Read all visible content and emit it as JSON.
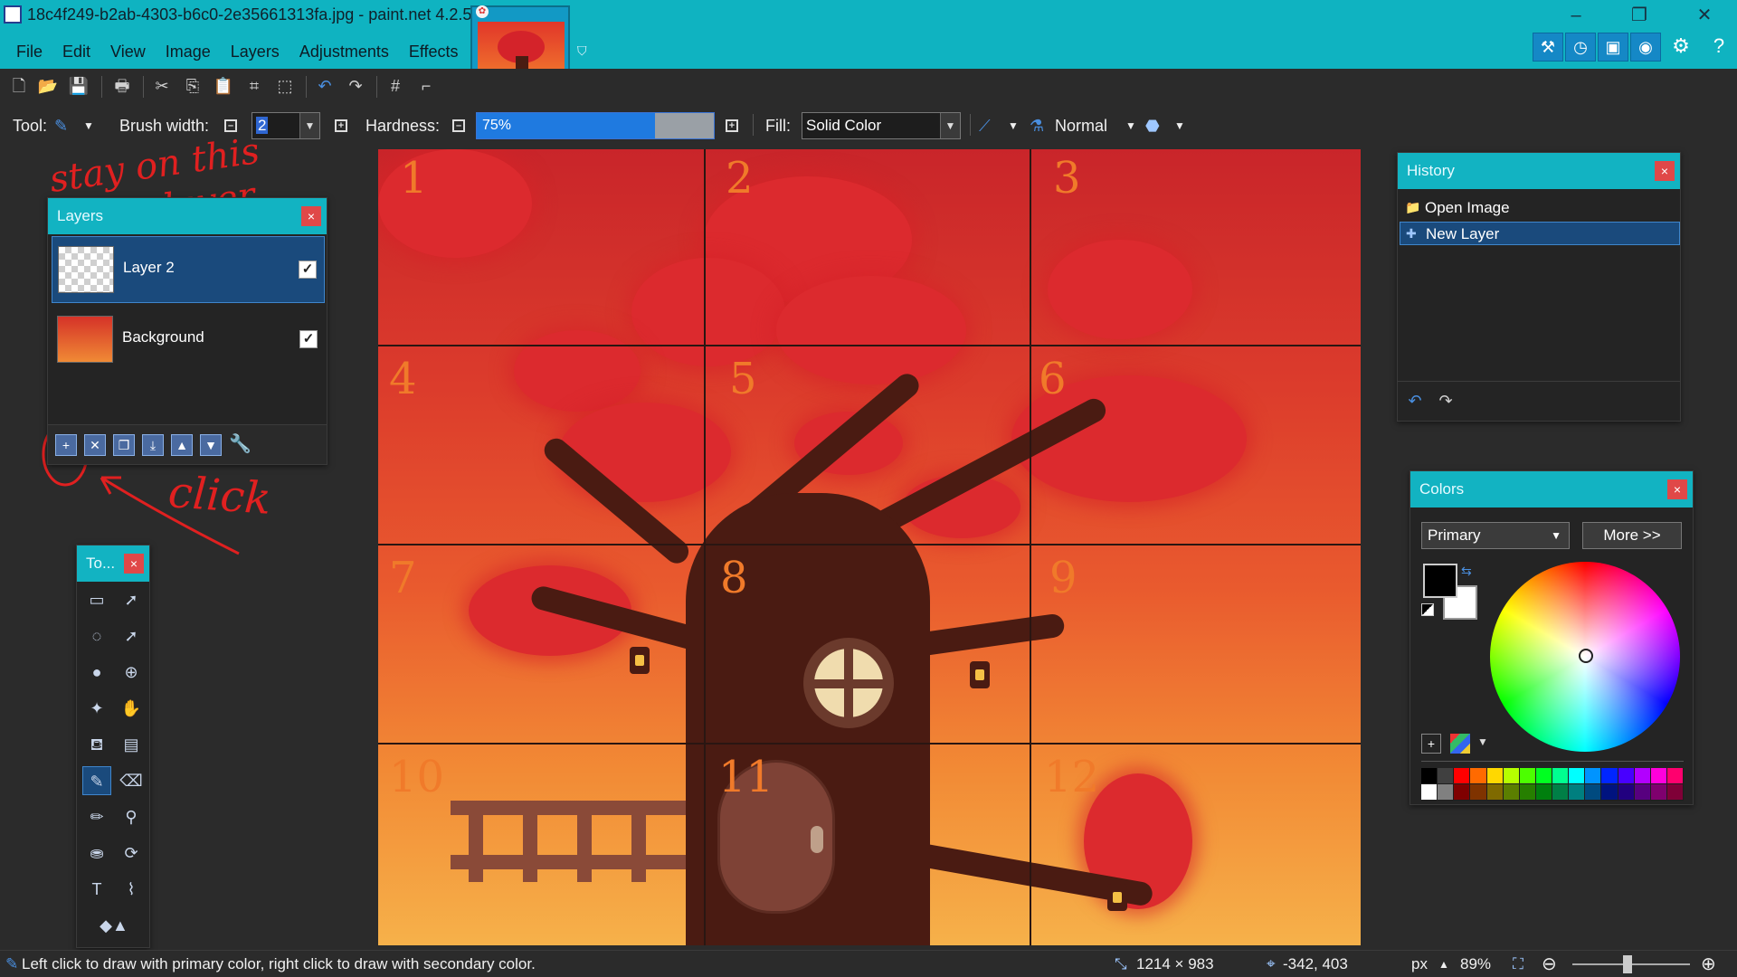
{
  "window": {
    "title": "18c4f249-b2ab-4303-b6c0-2e35661313fa.jpg - paint.net 4.2.5"
  },
  "menu": [
    "File",
    "Edit",
    "View",
    "Image",
    "Layers",
    "Adjustments",
    "Effects"
  ],
  "toolbar": {
    "tool_label": "Tool:",
    "brush_width_label": "Brush width:",
    "brush_width_value": "2",
    "hardness_label": "Hardness:",
    "hardness_value": "75%",
    "hardness_fraction": 0.75,
    "fill_label": "Fill:",
    "fill_value": "Solid Color",
    "blend_mode": "Normal"
  },
  "layers_panel": {
    "title": "Layers",
    "layers": [
      {
        "name": "Layer 2",
        "visible": true,
        "selected": true
      },
      {
        "name": "Background",
        "visible": true,
        "selected": false
      }
    ]
  },
  "tools_panel": {
    "title": "To..."
  },
  "history_panel": {
    "title": "History",
    "items": [
      {
        "label": "Open Image",
        "selected": false
      },
      {
        "label": "New Layer",
        "selected": true
      }
    ]
  },
  "colors_panel": {
    "title": "Colors",
    "mode": "Primary",
    "more_label": "More >>",
    "primary_color": "#000000",
    "secondary_color": "#ffffff",
    "palette": [
      "#000000",
      "#404040",
      "#ff0000",
      "#ff6a00",
      "#ffd800",
      "#b6ff00",
      "#4cff00",
      "#00ff21",
      "#00ff90",
      "#00ffff",
      "#0094ff",
      "#0026ff",
      "#4800ff",
      "#b200ff",
      "#ff00dc",
      "#ff006e",
      "#ffffff",
      "#808080",
      "#7f0000",
      "#7f3300",
      "#7f6a00",
      "#5b7f00",
      "#267f00",
      "#007f0e",
      "#007f46",
      "#007f7f",
      "#004a7f",
      "#00137f",
      "#21007f",
      "#57007f",
      "#7f006e",
      "#7f0037"
    ]
  },
  "annotations": {
    "stay_line1": "stay on this",
    "stay_line2": "layer",
    "click": "click"
  },
  "canvas_cells": [
    "1",
    "2",
    "3",
    "4",
    "5",
    "6",
    "7",
    "8",
    "9",
    "10",
    "11",
    "12"
  ],
  "status": {
    "hint": "Left click to draw with primary color, right click to draw with secondary color.",
    "image_size": "1214 × 983",
    "cursor_pos": "-342, 403",
    "units": "px",
    "zoom": "89%"
  },
  "theme": {
    "accent": "#12b3c2",
    "selection": "#1a4a7c",
    "panel_bg": "#242424"
  }
}
